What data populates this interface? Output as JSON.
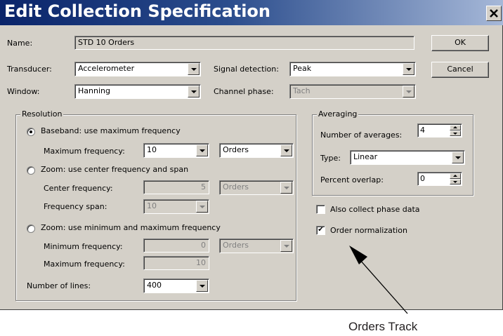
{
  "window": {
    "title": "Edit Collection Specification",
    "close_glyph": "✕"
  },
  "buttons": {
    "ok": "OK",
    "cancel": "Cancel"
  },
  "name": {
    "label": "Name:",
    "value": "STD 10 Orders"
  },
  "transducer": {
    "label": "Transducer:",
    "value": "Accelerometer"
  },
  "window_fn": {
    "label": "Window:",
    "value": "Hanning"
  },
  "signal_detection": {
    "label": "Signal detection:",
    "value": "Peak"
  },
  "channel_phase": {
    "label": "Channel phase:",
    "value": "Tach"
  },
  "resolution": {
    "title": "Resolution",
    "baseband": {
      "label": "Baseband: use maximum frequency",
      "selected": true,
      "max_freq_label": "Maximum frequency:",
      "max_freq_value": "10",
      "max_freq_unit": "Orders"
    },
    "zoom_center": {
      "label": "Zoom: use center frequency and span",
      "selected": false,
      "center_label": "Center frequency:",
      "center_value": "5",
      "center_unit": "Orders",
      "span_label": "Frequency span:",
      "span_value": "10"
    },
    "zoom_minmax": {
      "label": "Zoom: use minimum and maximum frequency",
      "selected": false,
      "min_label": "Minimum frequency:",
      "min_value": "0",
      "min_unit": "Orders",
      "max_label": "Maximum frequency:",
      "max_value": "10"
    },
    "lines": {
      "label": "Number of lines:",
      "value": "400"
    }
  },
  "averaging": {
    "title": "Averaging",
    "count": {
      "label": "Number of averages:",
      "value": "4"
    },
    "type": {
      "label": "Type:",
      "value": "Linear"
    },
    "overlap": {
      "label": "Percent overlap:",
      "value": "0"
    }
  },
  "options": {
    "phase": {
      "label": "Also collect phase data",
      "checked": false
    },
    "order_norm": {
      "label": "Order normalization",
      "checked": true,
      "mark": "✔"
    }
  },
  "annotation": {
    "text": "Orders Track"
  }
}
